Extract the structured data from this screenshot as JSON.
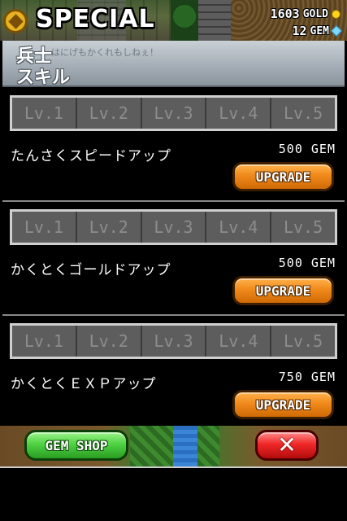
{
  "header": {
    "title": "SPECIAL",
    "gold_amount": "1603",
    "gold_unit": "GOLD",
    "gem_amount": "12",
    "gem_unit": "GEM",
    "icons": {
      "title": "special-emblem-icon",
      "gold": "gold-coin-icon",
      "gem": "gem-icon"
    }
  },
  "banner": {
    "title_line1": "兵士",
    "title_line2": "スキル",
    "background_text": "はにげもかくれもしねぇ！"
  },
  "skills": [
    {
      "name": "たんさくスピードアップ",
      "cost": "500 GEM",
      "levels": [
        "Lv.1",
        "Lv.2",
        "Lv.3",
        "Lv.4",
        "Lv.5"
      ],
      "levels_unlocked": 0,
      "button": "UPGRADE"
    },
    {
      "name": "かくとくゴールドアップ",
      "cost": "500 GEM",
      "levels": [
        "Lv.1",
        "Lv.2",
        "Lv.3",
        "Lv.4",
        "Lv.5"
      ],
      "levels_unlocked": 0,
      "button": "UPGRADE"
    },
    {
      "name": "かくとくＥＸＰアップ",
      "cost": "750 GEM",
      "levels": [
        "Lv.1",
        "Lv.2",
        "Lv.3",
        "Lv.4",
        "Lv.5"
      ],
      "levels_unlocked": 0,
      "button": "UPGRADE"
    }
  ],
  "footer": {
    "gem_shop_label": "GEM SHOP",
    "close_label": "✕",
    "close_icon": "close-icon"
  },
  "colors": {
    "upgrade_button": "#f08a1b",
    "gem_shop_button": "#4fd243",
    "close_button": "#f02828",
    "level_locked": "#5d5d5d"
  }
}
